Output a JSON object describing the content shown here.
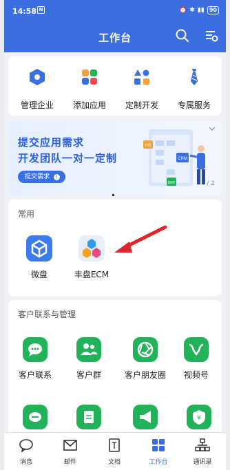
{
  "status": {
    "time": "14:58",
    "n": "N",
    "battery": "90"
  },
  "header": {
    "title": "工作台"
  },
  "quick_actions": [
    {
      "label": "管理企业",
      "icon": "hexagon-icon"
    },
    {
      "label": "添加应用",
      "icon": "apps-grid-icon"
    },
    {
      "label": "定制开发",
      "icon": "shapes-icon"
    },
    {
      "label": "专属服务",
      "icon": "tie-icon"
    }
  ],
  "banner": {
    "line1": "提交应用需求",
    "line2": "开发团队一对一定制",
    "button": "提交需求",
    "page": "/ 2",
    "tags": {
      "hr": "HR",
      "crm": "CRM",
      "erp": "ERP"
    }
  },
  "common": {
    "title": "常用",
    "apps": [
      {
        "label": "微盘",
        "icon": "cube-icon"
      },
      {
        "label": "丰盘ECM",
        "icon": "ecm-icon"
      }
    ]
  },
  "crm": {
    "title": "客户联系与管理",
    "apps": [
      {
        "label": "客户联系",
        "icon": "chat-bubble-icon"
      },
      {
        "label": "客户群",
        "icon": "people-icon"
      },
      {
        "label": "客户朋友圈",
        "icon": "aperture-icon"
      },
      {
        "label": "视频号",
        "icon": "video-channel-icon"
      }
    ]
  },
  "tabbar": [
    {
      "label": "消息",
      "icon": "message-icon",
      "active": false
    },
    {
      "label": "邮件",
      "icon": "mail-icon",
      "active": false
    },
    {
      "label": "文档",
      "icon": "document-icon",
      "active": false
    },
    {
      "label": "工作台",
      "icon": "workbench-icon",
      "active": true
    },
    {
      "label": "通讯录",
      "icon": "contacts-icon",
      "active": false
    }
  ],
  "colors": {
    "primary": "#3b6fe0",
    "green": "#22b25a",
    "arrow": "#e0262b"
  }
}
